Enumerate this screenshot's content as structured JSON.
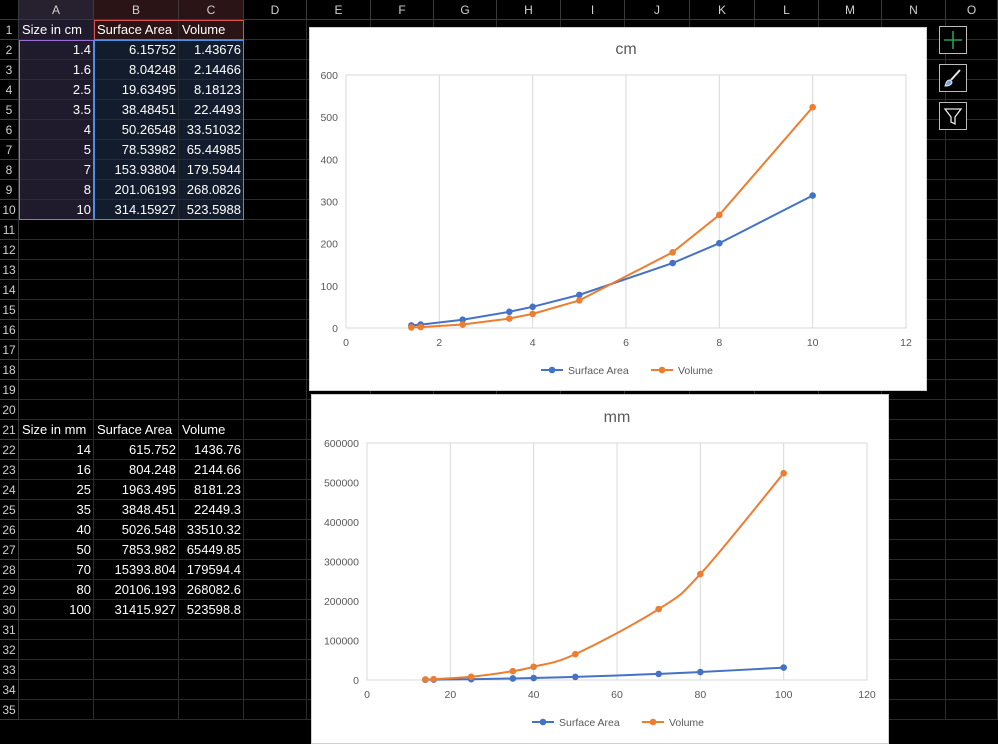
{
  "columns": [
    "A",
    "B",
    "C",
    "D",
    "E",
    "F",
    "G",
    "H",
    "I",
    "J",
    "K",
    "L",
    "M",
    "N",
    "O"
  ],
  "rows": [
    "1",
    "2",
    "3",
    "4",
    "5",
    "6",
    "7",
    "8",
    "9",
    "10",
    "11",
    "12",
    "13",
    "14",
    "15",
    "16",
    "17",
    "18",
    "19",
    "20",
    "21",
    "22",
    "23",
    "24",
    "25",
    "26",
    "27",
    "28",
    "29",
    "30",
    "31",
    "32",
    "33",
    "34",
    "35"
  ],
  "table_cm": {
    "headers": [
      "Size in cm",
      "Surface Area",
      "Volume"
    ],
    "rows": [
      [
        "1.4",
        "6.15752",
        "1.43676"
      ],
      [
        "1.6",
        "8.04248",
        "2.14466"
      ],
      [
        "2.5",
        "19.63495",
        "8.18123"
      ],
      [
        "3.5",
        "38.48451",
        "22.4493"
      ],
      [
        "4",
        "50.26548",
        "33.51032"
      ],
      [
        "5",
        "78.53982",
        "65.44985"
      ],
      [
        "7",
        "153.93804",
        "179.5944"
      ],
      [
        "8",
        "201.06193",
        "268.0826"
      ],
      [
        "10",
        "314.15927",
        "523.5988"
      ]
    ]
  },
  "table_mm": {
    "headers": [
      "Size in mm",
      "Surface Area",
      "Volume"
    ],
    "rows": [
      [
        "14",
        "615.752",
        "1436.76"
      ],
      [
        "16",
        "804.248",
        "2144.66"
      ],
      [
        "25",
        "1963.495",
        "8181.23"
      ],
      [
        "35",
        "3848.451",
        "22449.3"
      ],
      [
        "40",
        "5026.548",
        "33510.32"
      ],
      [
        "50",
        "7853.982",
        "65449.85"
      ],
      [
        "70",
        "15393.804",
        "179594.4"
      ],
      [
        "80",
        "20106.193",
        "268082.6"
      ],
      [
        "100",
        "31415.927",
        "523598.8"
      ]
    ]
  },
  "side_buttons": [
    {
      "name": "chart-elements-button",
      "icon": "plus-icon"
    },
    {
      "name": "chart-styles-button",
      "icon": "paintbrush-icon"
    },
    {
      "name": "chart-filters-button",
      "icon": "funnel-icon"
    }
  ],
  "colors": {
    "surface": "#4472c4",
    "volume": "#ed7d31",
    "grid": "#d9d9d9",
    "axis_text": "#595959"
  },
  "chart_data": [
    {
      "type": "scatter",
      "title": "cm",
      "xlim": [
        0,
        12
      ],
      "xticks": [
        0,
        2,
        4,
        6,
        8,
        10,
        12
      ],
      "ylim": [
        0,
        600
      ],
      "yticks": [
        0,
        100,
        200,
        300,
        400,
        500,
        600
      ],
      "xlabel": "",
      "ylabel": "",
      "grid": "vertical",
      "legend": "bottom",
      "smooth": false,
      "series": [
        {
          "name": "Surface Area",
          "color": "#4472c4",
          "x": [
            1.4,
            1.6,
            2.5,
            3.5,
            4,
            5,
            7,
            8,
            10
          ],
          "y": [
            6.15752,
            8.04248,
            19.63495,
            38.48451,
            50.26548,
            78.53982,
            153.93804,
            201.06193,
            314.15927
          ]
        },
        {
          "name": "Volume",
          "color": "#ed7d31",
          "x": [
            1.4,
            1.6,
            2.5,
            3.5,
            4,
            5,
            7,
            8,
            10
          ],
          "y": [
            1.43676,
            2.14466,
            8.18123,
            22.4493,
            33.51032,
            65.44985,
            179.5944,
            268.0826,
            523.5988
          ]
        }
      ]
    },
    {
      "type": "scatter",
      "title": "mm",
      "xlim": [
        0,
        120
      ],
      "xticks": [
        0,
        20,
        40,
        60,
        80,
        100,
        120
      ],
      "ylim": [
        0,
        600000
      ],
      "yticks": [
        0,
        100000,
        200000,
        300000,
        400000,
        500000,
        600000
      ],
      "xlabel": "",
      "ylabel": "",
      "grid": "vertical",
      "legend": "bottom",
      "smooth": true,
      "series": [
        {
          "name": "Surface Area",
          "color": "#4472c4",
          "x": [
            14,
            16,
            25,
            35,
            40,
            50,
            70,
            80,
            100
          ],
          "y": [
            615.752,
            804.248,
            1963.495,
            3848.451,
            5026.548,
            7853.982,
            15393.804,
            20106.193,
            31415.927
          ]
        },
        {
          "name": "Volume",
          "color": "#ed7d31",
          "x": [
            14,
            16,
            25,
            35,
            40,
            50,
            70,
            80,
            100
          ],
          "y": [
            1436.76,
            2144.66,
            8181.23,
            22449.3,
            33510.32,
            65449.85,
            179594.4,
            268082.6,
            523598.8
          ]
        }
      ]
    }
  ]
}
